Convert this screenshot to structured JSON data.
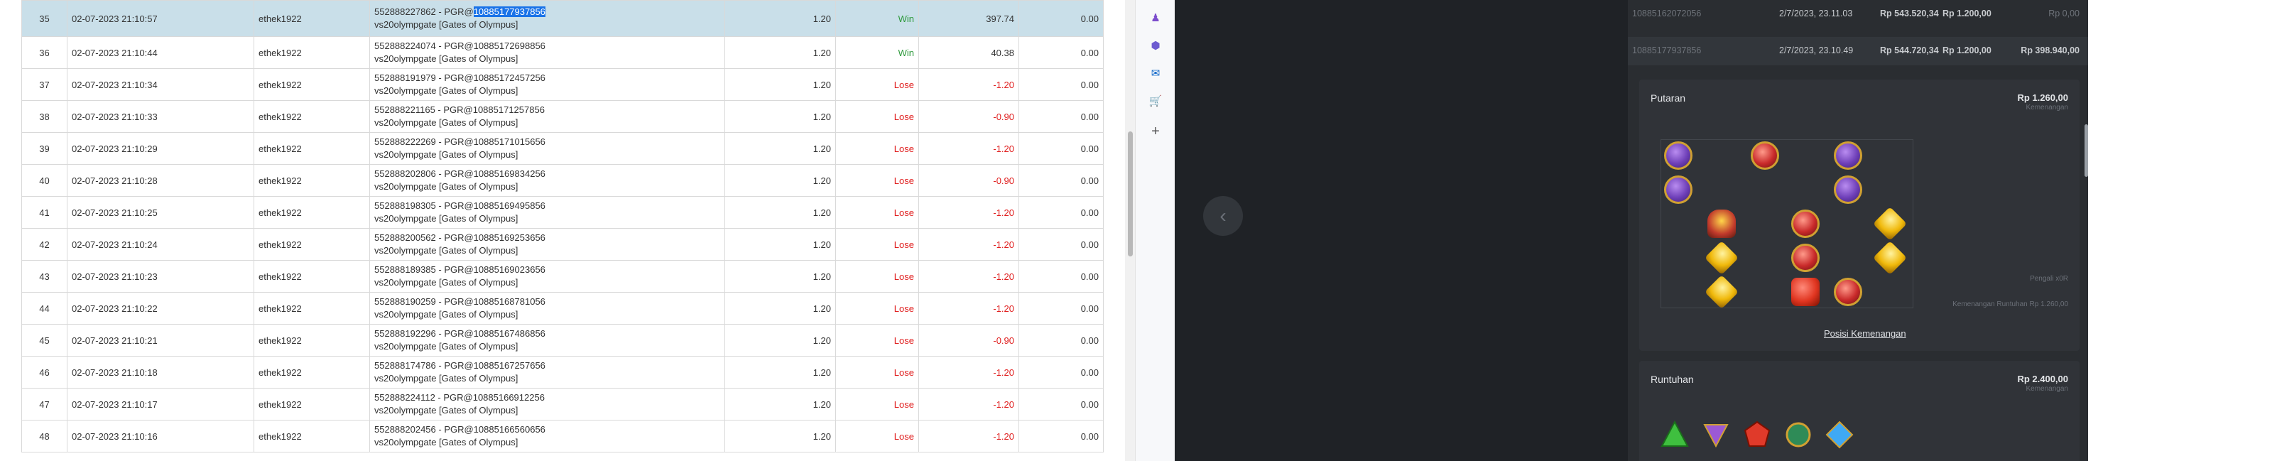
{
  "table": {
    "rows": [
      {
        "no": "35",
        "date": "02-07-2023 21:10:57",
        "user": "ethek1922",
        "id_prefix": "552888227862 - PGR@",
        "id_hl": "10885177937856",
        "game": "vs20olympgate [Gates of Olympus]",
        "bet": "1.20",
        "result": "Win",
        "win": "397.74",
        "extra": "0.00"
      },
      {
        "no": "36",
        "date": "02-07-2023 21:10:44",
        "user": "ethek1922",
        "id_prefix": "552888224074 - PGR@10885172698856",
        "id_hl": "",
        "game": "vs20olympgate [Gates of Olympus]",
        "bet": "1.20",
        "result": "Win",
        "win": "40.38",
        "extra": "0.00"
      },
      {
        "no": "37",
        "date": "02-07-2023 21:10:34",
        "user": "ethek1922",
        "id_prefix": "552888191979 - PGR@10885172457256",
        "id_hl": "",
        "game": "vs20olympgate [Gates of Olympus]",
        "bet": "1.20",
        "result": "Lose",
        "win": "-1.20",
        "extra": "0.00"
      },
      {
        "no": "38",
        "date": "02-07-2023 21:10:33",
        "user": "ethek1922",
        "id_prefix": "552888221165 - PGR@10885171257856",
        "id_hl": "",
        "game": "vs20olympgate [Gates of Olympus]",
        "bet": "1.20",
        "result": "Lose",
        "win": "-0.90",
        "extra": "0.00"
      },
      {
        "no": "39",
        "date": "02-07-2023 21:10:29",
        "user": "ethek1922",
        "id_prefix": "552888222269 - PGR@10885171015656",
        "id_hl": "",
        "game": "vs20olympgate [Gates of Olympus]",
        "bet": "1.20",
        "result": "Lose",
        "win": "-1.20",
        "extra": "0.00"
      },
      {
        "no": "40",
        "date": "02-07-2023 21:10:28",
        "user": "ethek1922",
        "id_prefix": "552888202806 - PGR@10885169834256",
        "id_hl": "",
        "game": "vs20olympgate [Gates of Olympus]",
        "bet": "1.20",
        "result": "Lose",
        "win": "-0.90",
        "extra": "0.00"
      },
      {
        "no": "41",
        "date": "02-07-2023 21:10:25",
        "user": "ethek1922",
        "id_prefix": "552888198305 - PGR@10885169495856",
        "id_hl": "",
        "game": "vs20olympgate [Gates of Olympus]",
        "bet": "1.20",
        "result": "Lose",
        "win": "-1.20",
        "extra": "0.00"
      },
      {
        "no": "42",
        "date": "02-07-2023 21:10:24",
        "user": "ethek1922",
        "id_prefix": "552888200562 - PGR@10885169253656",
        "id_hl": "",
        "game": "vs20olympgate [Gates of Olympus]",
        "bet": "1.20",
        "result": "Lose",
        "win": "-1.20",
        "extra": "0.00"
      },
      {
        "no": "43",
        "date": "02-07-2023 21:10:23",
        "user": "ethek1922",
        "id_prefix": "552888189385 - PGR@10885169023656",
        "id_hl": "",
        "game": "vs20olympgate [Gates of Olympus]",
        "bet": "1.20",
        "result": "Lose",
        "win": "-1.20",
        "extra": "0.00"
      },
      {
        "no": "44",
        "date": "02-07-2023 21:10:22",
        "user": "ethek1922",
        "id_prefix": "552888190259 - PGR@10885168781056",
        "id_hl": "",
        "game": "vs20olympgate [Gates of Olympus]",
        "bet": "1.20",
        "result": "Lose",
        "win": "-1.20",
        "extra": "0.00"
      },
      {
        "no": "45",
        "date": "02-07-2023 21:10:21",
        "user": "ethek1922",
        "id_prefix": "552888192296 - PGR@10885167486856",
        "id_hl": "",
        "game": "vs20olympgate [Gates of Olympus]",
        "bet": "1.20",
        "result": "Lose",
        "win": "-0.90",
        "extra": "0.00"
      },
      {
        "no": "46",
        "date": "02-07-2023 21:10:18",
        "user": "ethek1922",
        "id_prefix": "552888174786 - PGR@10885167257656",
        "id_hl": "",
        "game": "vs20olympgate [Gates of Olympus]",
        "bet": "1.20",
        "result": "Lose",
        "win": "-1.20",
        "extra": "0.00"
      },
      {
        "no": "47",
        "date": "02-07-2023 21:10:17",
        "user": "ethek1922",
        "id_prefix": "552888224112 - PGR@10885166912256",
        "id_hl": "",
        "game": "vs20olympgate [Gates of Olympus]",
        "bet": "1.20",
        "result": "Lose",
        "win": "-1.20",
        "extra": "0.00"
      },
      {
        "no": "48",
        "date": "02-07-2023 21:10:16",
        "user": "ethek1922",
        "id_prefix": "552888202456 - PGR@10885166560656",
        "id_hl": "",
        "game": "vs20olympgate [Gates of Olympus]",
        "bet": "1.20",
        "result": "Lose",
        "win": "-1.20",
        "extra": "0.00"
      }
    ]
  },
  "sidebar": {
    "icons": [
      "figure-icon",
      "puzzle-icon",
      "outlook-icon",
      "shopping-icon",
      "plus-icon"
    ]
  },
  "history": {
    "rows": [
      {
        "id": "10885162072056",
        "date": "2/7/2023, 23.11.03",
        "balance": "Rp 543.520,34",
        "bet": "Rp 1.200,00",
        "win": "Rp 0,00"
      },
      {
        "id": "10885177937856",
        "date": "2/7/2023, 23.10.49",
        "balance": "Rp 544.720,34",
        "bet": "Rp 1.200,00",
        "win": "Rp 398.940,00"
      }
    ]
  },
  "putaran": {
    "title": "Putaran",
    "amount": "Rp 1.260,00",
    "amount_sub": "Kemenangan",
    "pengali": "Pengali x0R",
    "runtuhan_note": "Kemenangan Runtuhan Rp 1.260,00",
    "link": "Posisi Kemenangan"
  },
  "runtuhan": {
    "title": "Runtuhan",
    "amount": "Rp 2.400,00",
    "amount_sub": "Kemenangan"
  },
  "colors": {
    "win": "#2e9a3c",
    "lose": "#e02020",
    "row_highlight": "#c9dfe9",
    "selection": "#1a73e8",
    "panel_dark": "#2a2d31"
  }
}
